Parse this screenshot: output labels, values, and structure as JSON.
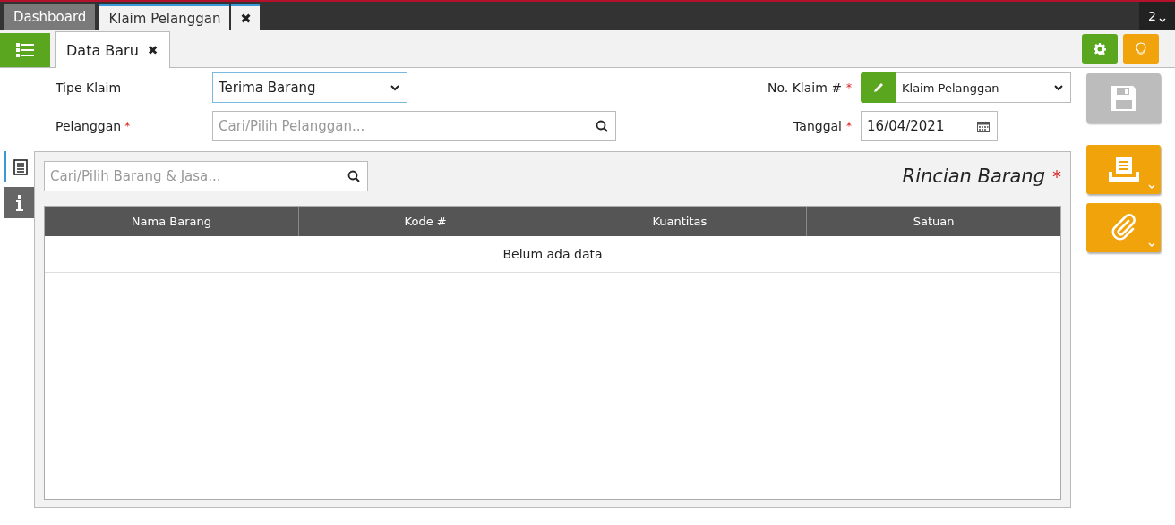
{
  "app_tabs": [
    {
      "label": "Dashboard",
      "selected": false
    },
    {
      "label": "Klaim Pelanggan",
      "selected": true
    }
  ],
  "app_tab_close": "✖",
  "window_count": "2",
  "sub_tabs": [
    {
      "label": "Data Baru",
      "close": "✖",
      "selected": true
    }
  ],
  "form_left": [
    {
      "label": "Tipe Klaim",
      "kind": "select",
      "value": "Terima Barang"
    },
    {
      "label": "Pelanggan",
      "required_mark": "*",
      "kind": "search",
      "placeholder": "Cari/Pilih Pelanggan..."
    }
  ],
  "form_right": [
    {
      "label": "No. Klaim #",
      "required_mark": "*",
      "kind": "select",
      "value": "Klaim Pelanggan"
    },
    {
      "label": "Tanggal",
      "required_mark": "*",
      "kind": "date",
      "value": "16/04/2021"
    }
  ],
  "side_tabs": [
    {
      "kind": "list",
      "selected": true
    },
    {
      "kind": "info",
      "selected": false
    }
  ],
  "item_search": {
    "placeholder": "Cari/Pilih Barang & Jasa..."
  },
  "section_title": "Rincian Barang",
  "section_required_mark": "*",
  "table": {
    "columns": [
      "Nama Barang",
      "Kode #",
      "Kuantitas",
      "Satuan"
    ],
    "empty_text": "Belum ada data"
  },
  "actions": [
    {
      "kind": "save",
      "disabled": true
    },
    {
      "kind": "print",
      "disabled": false
    },
    {
      "kind": "attach",
      "disabled": false
    }
  ]
}
